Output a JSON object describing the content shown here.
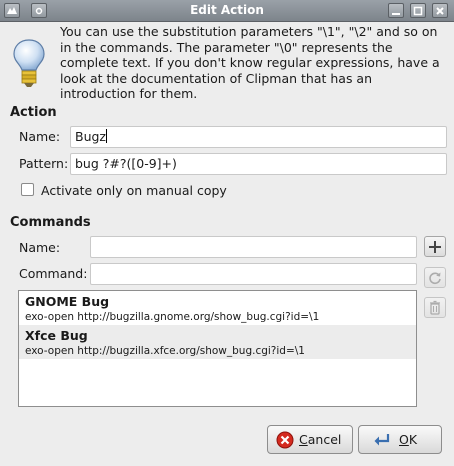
{
  "window": {
    "title": "Edit Action"
  },
  "info": {
    "text": "You can use the substitution parameters \"\\1\", \"\\2\" and so on in the commands. The parameter \"\\0\" represents the complete text. If you don't know regular expressions, have a look at the documentation of Clipman that has an introduction for them."
  },
  "action": {
    "heading": "Action",
    "name_label": "Name:",
    "name_value": "Bugz",
    "pattern_label": "Pattern:",
    "pattern_value": "bug ?#?([0-9]+)",
    "checkbox_label": "Activate only on manual copy",
    "checkbox_checked": false
  },
  "commands": {
    "heading": "Commands",
    "name_label": "Name:",
    "name_value": "",
    "command_label": "Command:",
    "command_value": "",
    "items": [
      {
        "name": "GNOME Bug",
        "command": "exo-open http://bugzilla.gnome.org/show_bug.cgi?id=\\1"
      },
      {
        "name": "Xfce Bug",
        "command": "exo-open http://bugzilla.xfce.org/show_bug.cgi?id=\\1"
      }
    ]
  },
  "buttons": {
    "cancel_mnemonic": "C",
    "cancel_rest": "ancel",
    "ok_mnemonic": "O",
    "ok_rest": "K"
  },
  "icons": {
    "window_menu": "xfce-logo-icon",
    "pin": "pin-icon",
    "close": "close-icon",
    "maximize": "maximize-icon",
    "minimize": "minimize-icon",
    "info": "lightbulb-icon",
    "add": "add-icon",
    "refresh": "refresh-icon",
    "delete": "trash-icon",
    "cancel": "cancel-icon",
    "ok": "ok-icon"
  },
  "colors": {
    "titlebar": "#8a9198",
    "cancel_red": "#d42a1f",
    "ok_blue": "#3a6fb0"
  }
}
